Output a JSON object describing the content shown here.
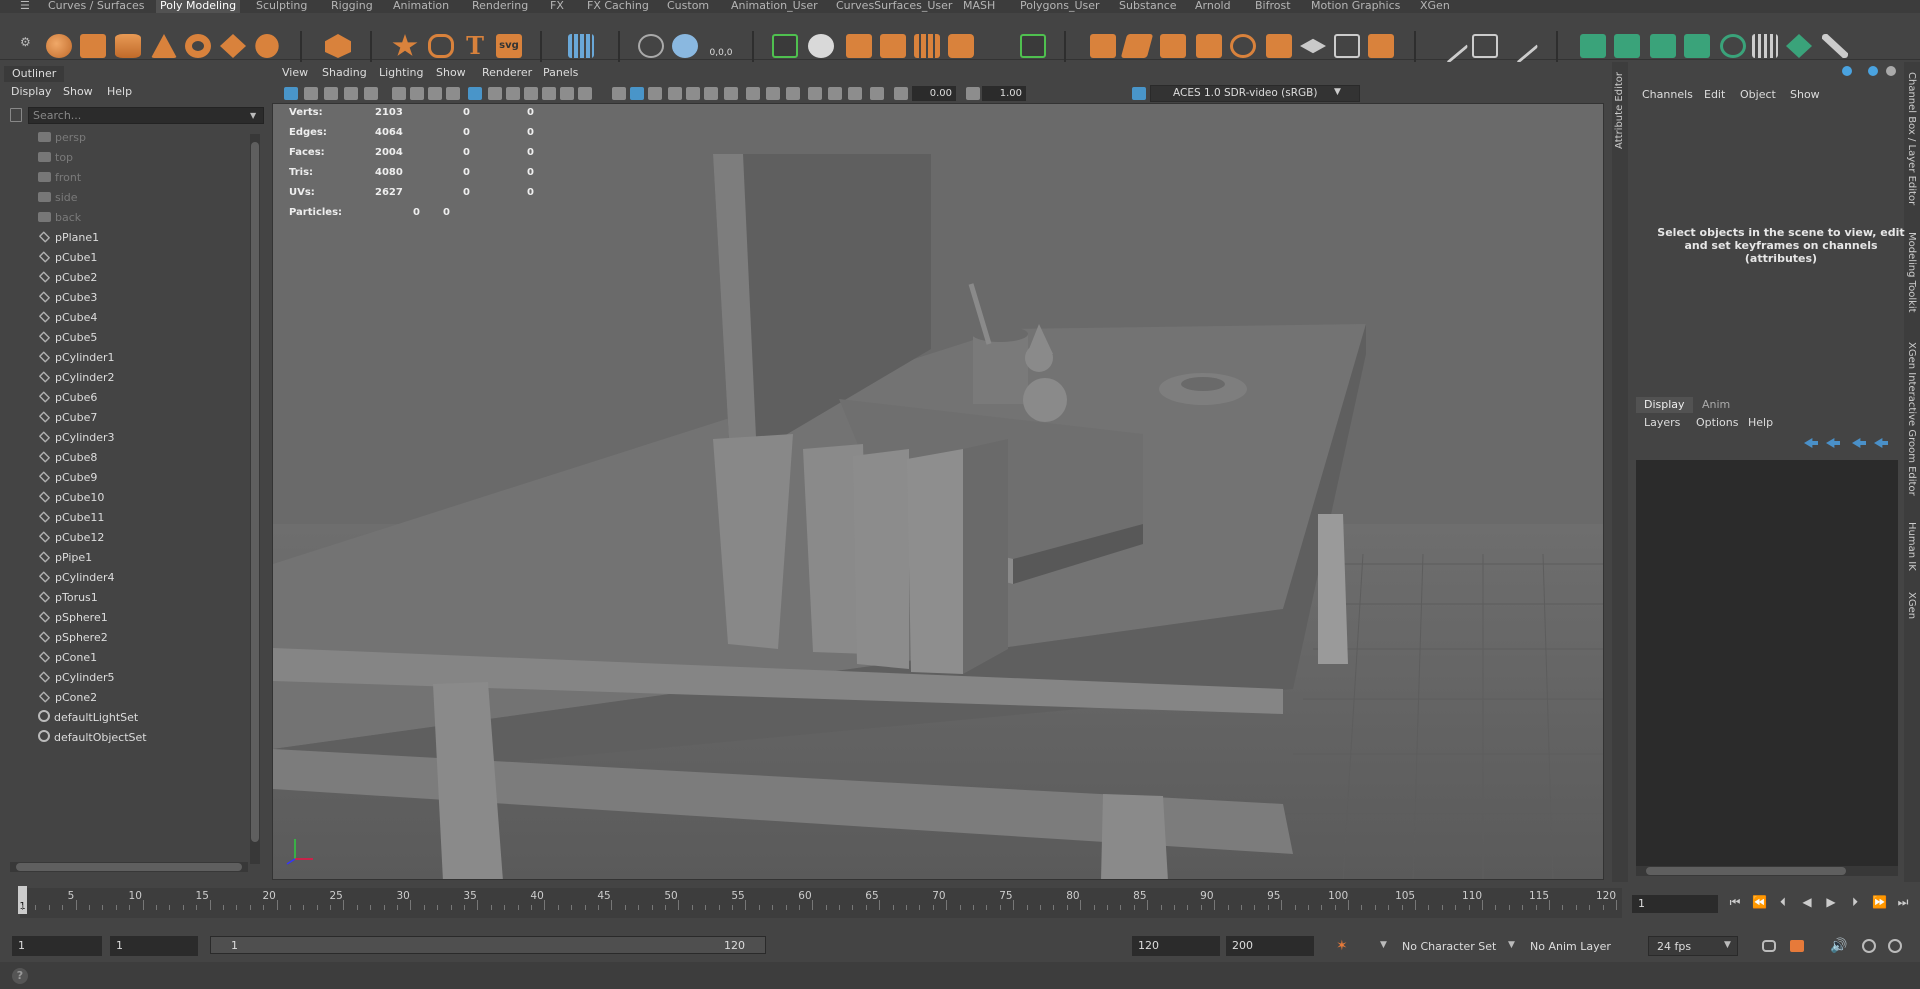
{
  "shelf": {
    "tabs": [
      "Curves / Surfaces",
      "Poly Modeling",
      "Sculpting",
      "Rigging",
      "Animation",
      "Rendering",
      "FX",
      "FX Caching",
      "Custom",
      "Animation_User",
      "CurvesSurfaces_User",
      "MASH",
      "Polygons_User",
      "Substance",
      "Arnold",
      "Bifrost",
      "Motion Graphics",
      "XGen"
    ],
    "active_tab": "Poly Modeling",
    "icons": [
      "sphere-icon",
      "cube-icon",
      "cylinder-icon",
      "cone-icon",
      "torus-icon",
      "plane-icon",
      "sculpt-icon",
      "star-icon",
      "helix-icon",
      "text-icon",
      "svg-icon",
      "grid-icon",
      "snap-icon",
      "transform-icon",
      "coords-icon",
      "pivot-icon",
      "bool-icon",
      "combine-icon",
      "separate-icon",
      "extrude-icon",
      "bevel-icon",
      "bridge-icon",
      "quad-icon",
      "multicut-icon",
      "smooth-icon",
      "mirror-icon",
      "bridge2-icon",
      "merge-icon",
      "uv-icon",
      "edge-icon",
      "loop-icon",
      "target-icon"
    ],
    "svg_label": "svg",
    "coords_label": "0,0,0",
    "text_label": "T"
  },
  "outliner": {
    "title": "Outliner",
    "menu": [
      "Display",
      "Show",
      "Help"
    ],
    "search_placeholder": "Search...",
    "items": [
      {
        "label": "persp",
        "type": "camera",
        "dim": true
      },
      {
        "label": "top",
        "type": "camera",
        "dim": true
      },
      {
        "label": "front",
        "type": "camera",
        "dim": true
      },
      {
        "label": "side",
        "type": "camera",
        "dim": true
      },
      {
        "label": "back",
        "type": "camera",
        "dim": true
      },
      {
        "label": "pPlane1",
        "type": "mesh"
      },
      {
        "label": "pCube1",
        "type": "mesh"
      },
      {
        "label": "pCube2",
        "type": "mesh"
      },
      {
        "label": "pCube3",
        "type": "mesh"
      },
      {
        "label": "pCube4",
        "type": "mesh"
      },
      {
        "label": "pCube5",
        "type": "mesh"
      },
      {
        "label": "pCylinder1",
        "type": "mesh"
      },
      {
        "label": "pCylinder2",
        "type": "mesh"
      },
      {
        "label": "pCube6",
        "type": "mesh"
      },
      {
        "label": "pCube7",
        "type": "mesh"
      },
      {
        "label": "pCylinder3",
        "type": "mesh"
      },
      {
        "label": "pCube8",
        "type": "mesh"
      },
      {
        "label": "pCube9",
        "type": "mesh"
      },
      {
        "label": "pCube10",
        "type": "mesh"
      },
      {
        "label": "pCube11",
        "type": "mesh"
      },
      {
        "label": "pCube12",
        "type": "mesh"
      },
      {
        "label": "pPipe1",
        "type": "mesh"
      },
      {
        "label": "pCylinder4",
        "type": "mesh"
      },
      {
        "label": "pTorus1",
        "type": "mesh"
      },
      {
        "label": "pSphere1",
        "type": "mesh"
      },
      {
        "label": "pSphere2",
        "type": "mesh"
      },
      {
        "label": "pCone1",
        "type": "mesh"
      },
      {
        "label": "pCylinder5",
        "type": "mesh"
      },
      {
        "label": "pCone2",
        "type": "mesh"
      },
      {
        "label": "defaultLightSet",
        "type": "set"
      },
      {
        "label": "defaultObjectSet",
        "type": "set"
      }
    ]
  },
  "viewport": {
    "menu": [
      "View",
      "Shading",
      "Lighting",
      "Show",
      "Renderer",
      "Panels"
    ],
    "exposure": "0.00",
    "gamma": "1.00",
    "color_space": "ACES 1.0 SDR-video (sRGB)",
    "hud": [
      {
        "label": "Verts:",
        "v1": "2103",
        "v2": "0",
        "v3": "0"
      },
      {
        "label": "Edges:",
        "v1": "4064",
        "v2": "0",
        "v3": "0"
      },
      {
        "label": "Faces:",
        "v1": "2004",
        "v2": "0",
        "v3": "0"
      },
      {
        "label": "Tris:",
        "v1": "4080",
        "v2": "0",
        "v3": "0"
      },
      {
        "label": "UVs:",
        "v1": "2627",
        "v2": "0",
        "v3": "0"
      },
      {
        "label": "Particles:",
        "v1": "0",
        "v2": "0",
        "v3": ""
      }
    ]
  },
  "right_tabs": [
    "Channel Box / Layer Editor",
    "Modeling Toolkit",
    "XGen Interactive Groom Editor",
    "Human IK",
    "XGen"
  ],
  "left_tabs": [
    "Attribute Editor"
  ],
  "channel_box": {
    "menu": [
      "Channels",
      "Edit",
      "Object",
      "Show"
    ],
    "message": "Select objects in the scene to view, edit and set keyframes on channels (attributes)"
  },
  "layer_editor": {
    "tabs": [
      "Display",
      "Anim"
    ],
    "active_tab": "Display",
    "menu": [
      "Layers",
      "Options",
      "Help"
    ]
  },
  "timeline": {
    "ticks": [
      "5",
      "10",
      "15",
      "20",
      "25",
      "30",
      "35",
      "40",
      "45",
      "50",
      "55",
      "60",
      "65",
      "70",
      "75",
      "80",
      "85",
      "90",
      "95",
      "100",
      "105",
      "110",
      "115",
      "120"
    ],
    "current_frame_marker": "1",
    "current_frame": "1"
  },
  "range": {
    "start": "1",
    "playback_start": "1",
    "slider_start": "1",
    "slider_end": "120",
    "playback_end": "120",
    "end": "200",
    "character_set": "No Character Set",
    "anim_layer": "No Anim Layer",
    "fps": "24 fps"
  }
}
